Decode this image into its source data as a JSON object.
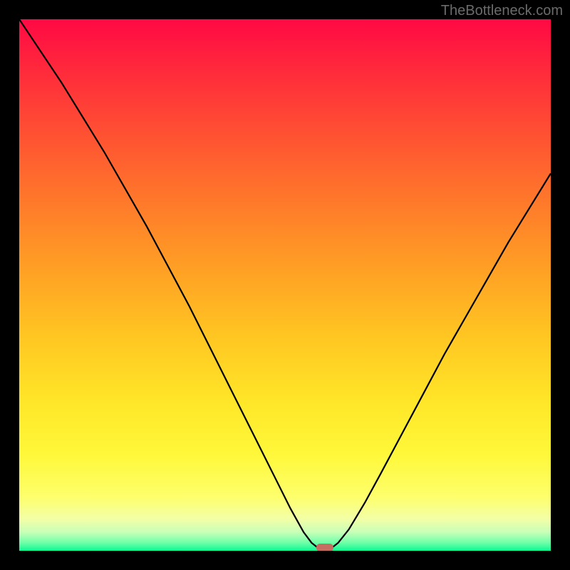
{
  "watermark": "TheBottleneck.com",
  "chart_data": {
    "type": "line",
    "title": "",
    "xlabel": "",
    "ylabel": "",
    "xlim": [
      0,
      100
    ],
    "ylim": [
      0,
      100
    ],
    "curve": [
      {
        "x": 0.0,
        "y": 100.0
      },
      {
        "x": 4.0,
        "y": 94.0
      },
      {
        "x": 8.0,
        "y": 88.0
      },
      {
        "x": 12.0,
        "y": 81.5
      },
      {
        "x": 16.0,
        "y": 75.0
      },
      {
        "x": 20.0,
        "y": 68.0
      },
      {
        "x": 24.0,
        "y": 61.0
      },
      {
        "x": 28.0,
        "y": 53.5
      },
      {
        "x": 32.0,
        "y": 46.0
      },
      {
        "x": 36.0,
        "y": 38.0
      },
      {
        "x": 40.0,
        "y": 30.0
      },
      {
        "x": 44.0,
        "y": 22.0
      },
      {
        "x": 48.0,
        "y": 14.0
      },
      {
        "x": 51.0,
        "y": 8.0
      },
      {
        "x": 53.5,
        "y": 3.5
      },
      {
        "x": 55.0,
        "y": 1.5
      },
      {
        "x": 56.0,
        "y": 0.7
      },
      {
        "x": 57.0,
        "y": 0.5
      },
      {
        "x": 58.0,
        "y": 0.5
      },
      {
        "x": 59.0,
        "y": 0.7
      },
      {
        "x": 60.0,
        "y": 1.5
      },
      {
        "x": 62.0,
        "y": 4.0
      },
      {
        "x": 65.0,
        "y": 9.0
      },
      {
        "x": 68.0,
        "y": 14.5
      },
      {
        "x": 72.0,
        "y": 22.0
      },
      {
        "x": 76.0,
        "y": 29.5
      },
      {
        "x": 80.0,
        "y": 37.0
      },
      {
        "x": 84.0,
        "y": 44.0
      },
      {
        "x": 88.0,
        "y": 51.0
      },
      {
        "x": 92.0,
        "y": 58.0
      },
      {
        "x": 96.0,
        "y": 64.5
      },
      {
        "x": 100.0,
        "y": 71.0
      }
    ],
    "marker": {
      "x": 57.5,
      "y": 0.6,
      "color": "#c56e62"
    },
    "gradient_stops": [
      {
        "offset": 0.0,
        "color": "#ff0944"
      },
      {
        "offset": 0.1,
        "color": "#ff2b3b"
      },
      {
        "offset": 0.22,
        "color": "#ff5232"
      },
      {
        "offset": 0.35,
        "color": "#ff7b2a"
      },
      {
        "offset": 0.48,
        "color": "#ffa324"
      },
      {
        "offset": 0.6,
        "color": "#ffc722"
      },
      {
        "offset": 0.72,
        "color": "#ffe628"
      },
      {
        "offset": 0.82,
        "color": "#fff83a"
      },
      {
        "offset": 0.9,
        "color": "#fdff6d"
      },
      {
        "offset": 0.94,
        "color": "#f3ffa6"
      },
      {
        "offset": 0.965,
        "color": "#c8ffb8"
      },
      {
        "offset": 0.985,
        "color": "#6effa8"
      },
      {
        "offset": 1.0,
        "color": "#0cf992"
      }
    ]
  }
}
